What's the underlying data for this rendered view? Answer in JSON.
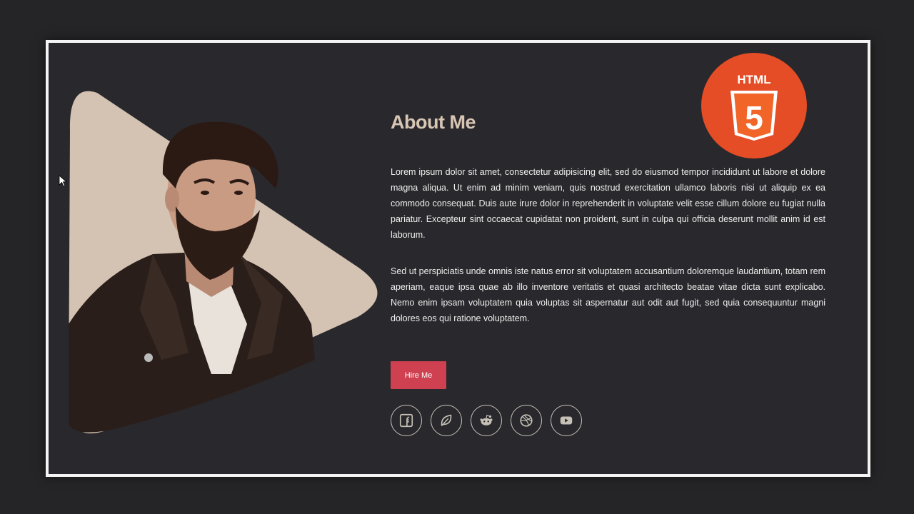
{
  "about": {
    "title": "About Me",
    "paragraph_1": "Lorem ipsum dolor sit amet, consectetur adipisicing elit, sed do eiusmod tempor incididunt ut labore et dolore magna aliqua. Ut enim ad minim veniam, quis nostrud exercitation ullamco laboris nisi ut aliquip ex ea commodo consequat. Duis aute irure dolor in reprehenderit in voluptate velit esse cillum dolore eu fugiat nulla pariatur. Excepteur sint occaecat cupidatat non proident, sunt in culpa qui officia deserunt mollit anim id est laborum.",
    "paragraph_2": "Sed ut perspiciatis unde omnis iste natus error sit voluptatem accusantium doloremque laudantium, totam rem aperiam, eaque ipsa quae ab illo inventore veritatis et quasi architecto beatae vitae dicta sunt explicabo. Nemo enim ipsam voluptatem quia voluptas sit aspernatur aut odit aut fugit, sed quia consequuntur magni dolores eos qui ratione voluptatem."
  },
  "cta": {
    "hire_label": "Hire Me"
  },
  "badge": {
    "text": "HTML",
    "number": "5",
    "color": "#e44d26"
  },
  "socials": [
    {
      "icon": "facebook-icon"
    },
    {
      "icon": "leaf-icon"
    },
    {
      "icon": "reddit-icon"
    },
    {
      "icon": "dribbble-icon"
    },
    {
      "icon": "youtube-icon"
    }
  ],
  "colors": {
    "accent": "#cf4050",
    "heading": "#d8c6b5",
    "panel_bg": "#29282c",
    "shape": "#d4c3b3"
  }
}
